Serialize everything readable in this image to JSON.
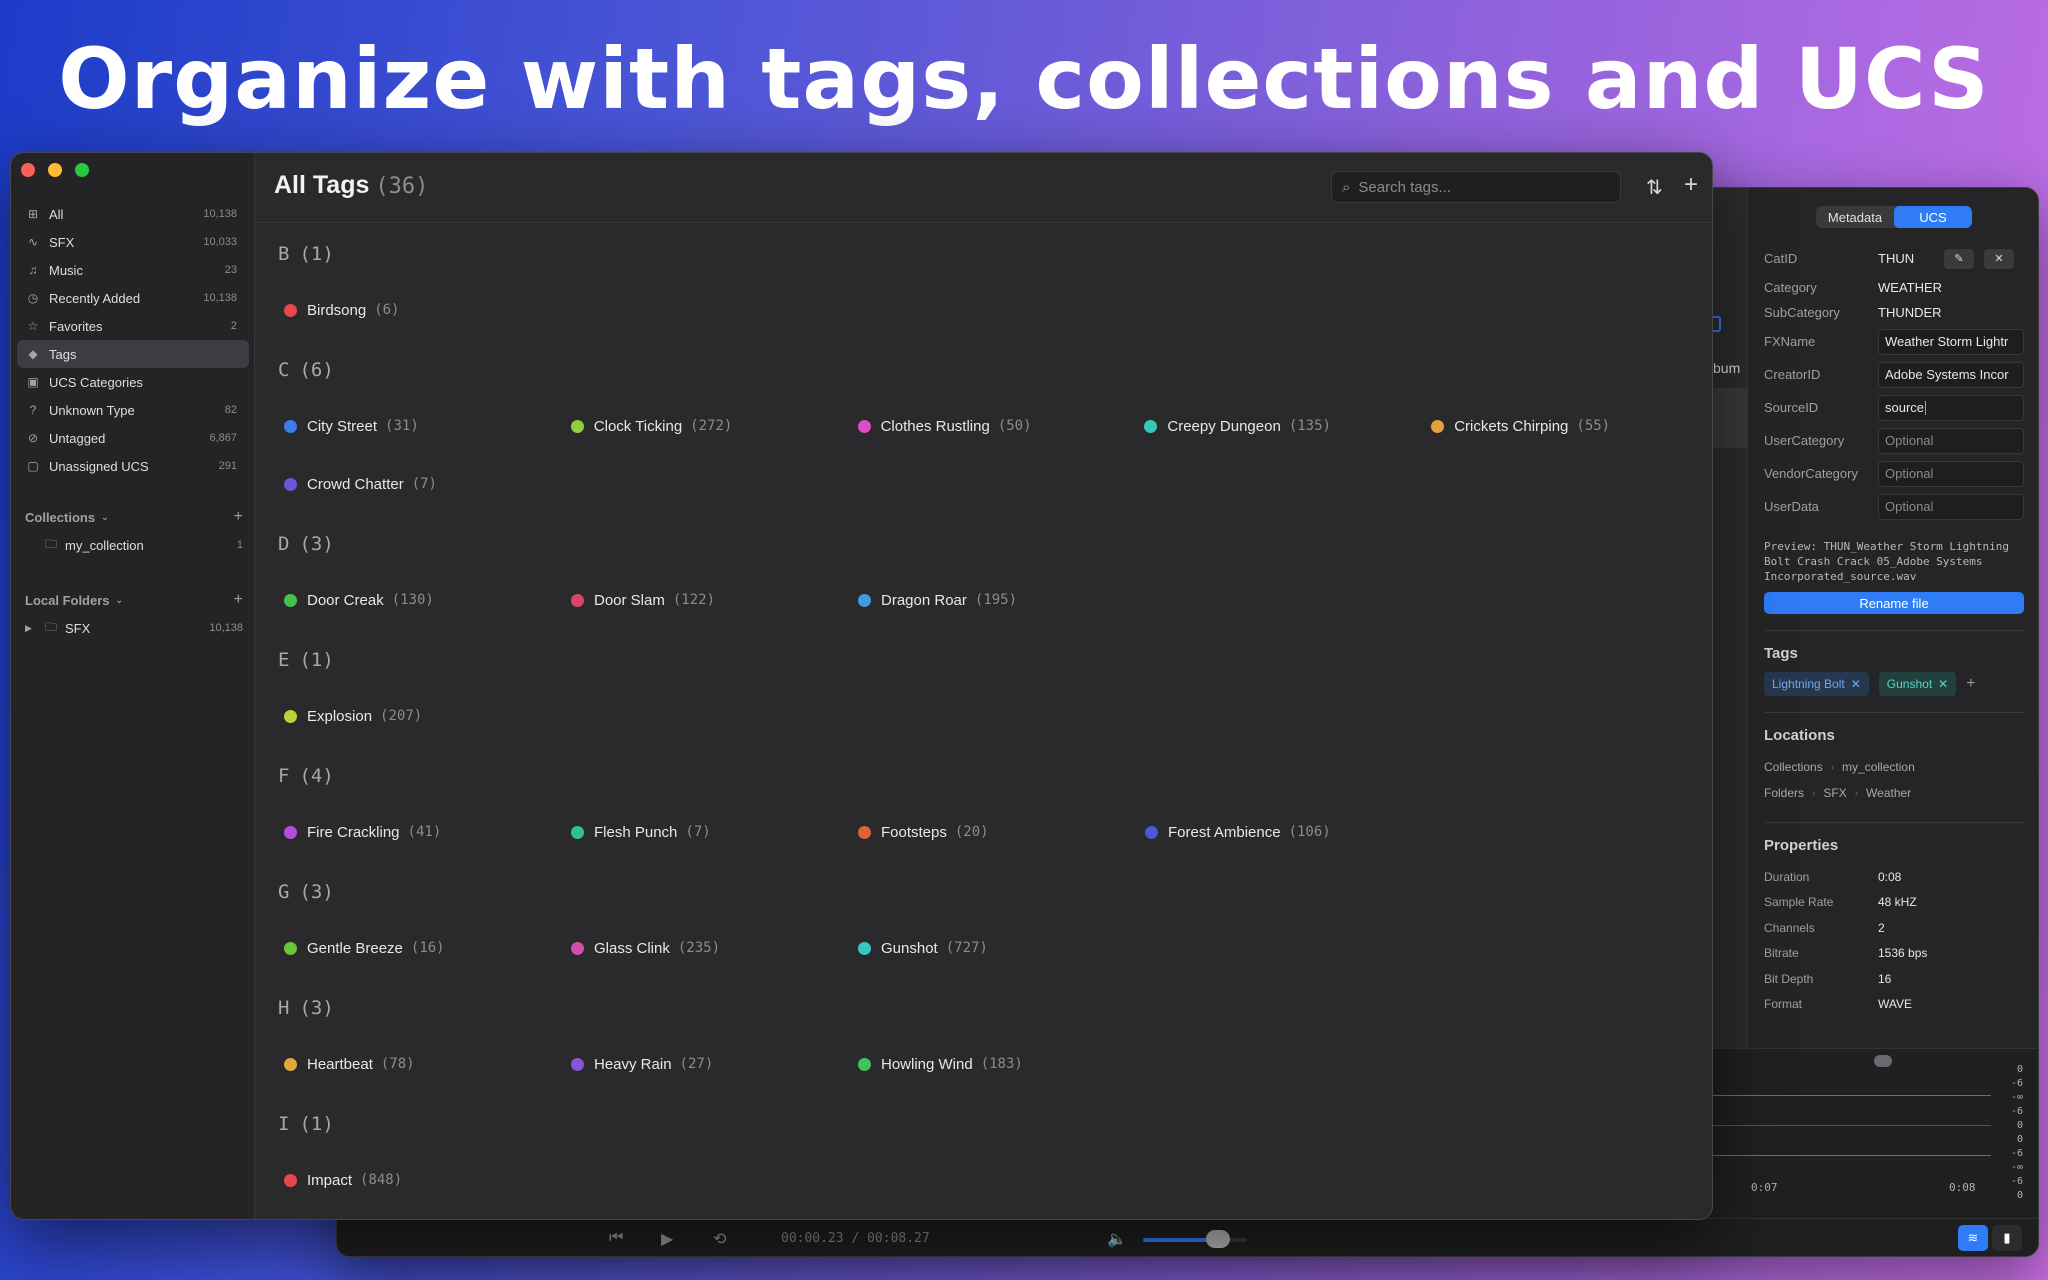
{
  "headline": "Organize with tags, collections and UCS",
  "sidebar": {
    "items": [
      {
        "label": "All",
        "count": "10,138",
        "icon": "grid-icon"
      },
      {
        "label": "SFX",
        "count": "10,033",
        "icon": "waveform-icon"
      },
      {
        "label": "Music",
        "count": "23",
        "icon": "music-note-icon"
      },
      {
        "label": "Recently Added",
        "count": "10,138",
        "icon": "clock-icon"
      },
      {
        "label": "Favorites",
        "count": "2",
        "icon": "star-icon"
      },
      {
        "label": "Tags",
        "count": "",
        "icon": "tag-icon"
      },
      {
        "label": "UCS Categories",
        "count": "",
        "icon": "category-icon"
      },
      {
        "label": "Unknown Type",
        "count": "82",
        "icon": "question-icon"
      },
      {
        "label": "Untagged",
        "count": "6,867",
        "icon": "tag-slash-icon"
      },
      {
        "label": "Unassigned UCS",
        "count": "291",
        "icon": "unassigned-icon"
      }
    ],
    "collections": {
      "label": "Collections",
      "items": [
        {
          "label": "my_collection",
          "count": "1"
        }
      ]
    },
    "local_folders": {
      "label": "Local Folders",
      "items": [
        {
          "label": "SFX",
          "count": "10,138"
        }
      ]
    }
  },
  "main": {
    "title": "All Tags",
    "count": "(36)",
    "search_placeholder": "Search tags...",
    "groups": [
      {
        "letter": "B",
        "count": "(1)",
        "rows": [
          [
            {
              "name": "Birdsong",
              "count": "(6)",
              "color": "#e5484d"
            }
          ]
        ]
      },
      {
        "letter": "C",
        "count": "(6)",
        "rows": [
          [
            {
              "name": "City Street",
              "count": "(31)",
              "color": "#3e7bea"
            },
            {
              "name": "Clock Ticking",
              "count": "(272)",
              "color": "#8fcf3c"
            },
            {
              "name": "Clothes Rustling",
              "count": "(50)",
              "color": "#d94fc4"
            },
            {
              "name": "Creepy Dungeon",
              "count": "(135)",
              "color": "#34c9b5"
            },
            {
              "name": "Crickets Chirping",
              "count": "(55)",
              "color": "#e5a23c"
            }
          ],
          [
            {
              "name": "Crowd Chatter",
              "count": "(7)",
              "color": "#6a54d8"
            }
          ]
        ]
      },
      {
        "letter": "D",
        "count": "(3)",
        "rows": [
          [
            {
              "name": "Door Creak",
              "count": "(130)",
              "color": "#45c24c"
            },
            {
              "name": "Door Slam",
              "count": "(122)",
              "color": "#d9456a"
            },
            {
              "name": "Dragon Roar",
              "count": "(195)",
              "color": "#3f9ae0"
            }
          ]
        ]
      },
      {
        "letter": "E",
        "count": "(1)",
        "rows": [
          [
            {
              "name": "Explosion",
              "count": "(207)",
              "color": "#b8d43a"
            }
          ]
        ]
      },
      {
        "letter": "F",
        "count": "(4)",
        "rows": [
          [
            {
              "name": "Fire Crackling",
              "count": "(41)",
              "color": "#b450d8"
            },
            {
              "name": "Flesh Punch",
              "count": "(7)",
              "color": "#2fc48a"
            },
            {
              "name": "Footsteps",
              "count": "(20)",
              "color": "#e0623c"
            },
            {
              "name": "Forest Ambience",
              "count": "(106)",
              "color": "#4e56d6"
            }
          ]
        ]
      },
      {
        "letter": "G",
        "count": "(3)",
        "rows": [
          [
            {
              "name": "Gentle Breeze",
              "count": "(16)",
              "color": "#6cc43c"
            },
            {
              "name": "Glass Clink",
              "count": "(235)",
              "color": "#d04fa8"
            },
            {
              "name": "Gunshot",
              "count": "(727)",
              "color": "#36c7c0"
            }
          ]
        ]
      },
      {
        "letter": "H",
        "count": "(3)",
        "rows": [
          [
            {
              "name": "Heartbeat",
              "count": "(78)",
              "color": "#e0a83a"
            },
            {
              "name": "Heavy Rain",
              "count": "(27)",
              "color": "#8a54d8"
            },
            {
              "name": "Howling Wind",
              "count": "(183)",
              "color": "#3ec45a"
            }
          ]
        ]
      },
      {
        "letter": "I",
        "count": "(1)",
        "rows": [
          [
            {
              "name": "Impact",
              "count": "(848)",
              "color": "#e5484d"
            }
          ]
        ]
      }
    ]
  },
  "inspector": {
    "tab_metadata": "Metadata",
    "tab_ucs": "UCS",
    "ucs": {
      "catid_label": "CatID",
      "catid": "THUN",
      "category_label": "Category",
      "category": "WEATHER",
      "subcategory_label": "SubCategory",
      "subcategory": "THUNDER",
      "fxname_label": "FXName",
      "fxname": "Weather Storm Lightr",
      "creatorid_label": "CreatorID",
      "creatorid": "Adobe Systems Incor",
      "sourceid_label": "SourceID",
      "sourceid": "source",
      "usercategory_label": "UserCategory",
      "usercategory_placeholder": "Optional",
      "vendorcategory_label": "VendorCategory",
      "vendorcategory_placeholder": "Optional",
      "userdata_label": "UserData",
      "userdata_placeholder": "Optional"
    },
    "preview": "Preview: THUN_Weather Storm Lightning Bolt Crash Crack 05_Adobe Systems Incorporated_source.wav",
    "rename_label": "Rename file",
    "tags_heading": "Tags",
    "tags": [
      {
        "label": "Lightning Bolt",
        "style": "blue"
      },
      {
        "label": "Gunshot",
        "style": "teal"
      }
    ],
    "locations_heading": "Locations",
    "locations": [
      [
        "Collections",
        "my_collection"
      ],
      [
        "Folders",
        "SFX",
        "Weather"
      ]
    ],
    "properties_heading": "Properties",
    "properties": [
      {
        "key": "Duration",
        "value": "0:08"
      },
      {
        "key": "Sample Rate",
        "value": "48 kHZ"
      },
      {
        "key": "Channels",
        "value": "2"
      },
      {
        "key": "Bitrate",
        "value": "1536 bps"
      },
      {
        "key": "Bit Depth",
        "value": "16"
      },
      {
        "key": "Format",
        "value": "WAVE"
      }
    ]
  },
  "back_list": {
    "column_label": "bum"
  },
  "waveform": {
    "db_labels": [
      "0",
      "-6",
      "-∞",
      "-6",
      "0",
      "0",
      "-6",
      "-∞",
      "-6",
      "0"
    ],
    "time_start": "0:07",
    "time_end": "0:08"
  },
  "transport": {
    "time": "00:00.23 / 00:08.27",
    "volume": 0.72
  }
}
